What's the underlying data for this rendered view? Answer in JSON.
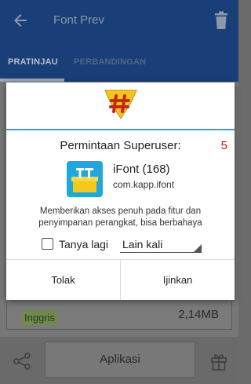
{
  "app": {
    "title": "Font Prev",
    "tabs": [
      {
        "label": "PRATINJAU",
        "active": true
      },
      {
        "label": "PERBANDINGAN",
        "active": false
      }
    ],
    "info": {
      "language": "Inggris",
      "size": "2,14MB"
    },
    "bottom": {
      "apply_label": "Aplikasi"
    }
  },
  "dialog": {
    "title": "Permintaan Superuser:",
    "count": "5",
    "app_name": "iFont (168)",
    "package": "com.kapp.ifont",
    "message": "Memberikan akses penuh pada fitur dan penyimpanan perangkat, bisa berbahaya",
    "remember_label": "Tanya lagi",
    "remember_checked": false,
    "duration_selected": "Lain kali",
    "deny_label": "Tolak",
    "allow_label": "Ijinkan"
  },
  "colors": {
    "appbar": "#1a3f78",
    "divider": "#33a5cf",
    "count": "#d01010",
    "ifont_icon_bg": "#21a6dd"
  },
  "icons": {
    "back": "arrow-left-icon",
    "trash": "trash-icon",
    "share": "share-icon",
    "gift": "gift-icon",
    "superuser": "superuser-shield-icon",
    "app": "ifont-app-icon"
  }
}
